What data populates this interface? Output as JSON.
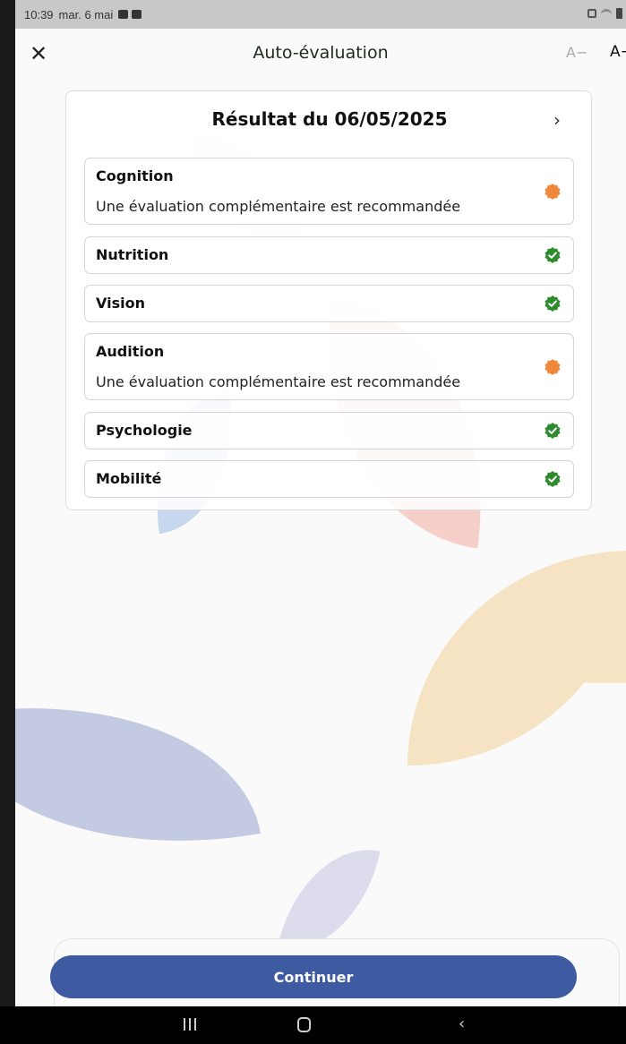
{
  "status_bar": {
    "time": "10:39",
    "date": "mar. 6 mai"
  },
  "header": {
    "close_glyph": "✕",
    "title": "Auto-évaluation",
    "font_decrease": "A−",
    "font_increase": "A+"
  },
  "card": {
    "title": "Résultat du 06/05/2025",
    "next_glyph": "›",
    "rows": [
      {
        "label": "Cognition",
        "sub": "Une évaluation complémentaire est recommandée",
        "status": "warning"
      },
      {
        "label": "Nutrition",
        "status": "ok"
      },
      {
        "label": "Vision",
        "status": "ok"
      },
      {
        "label": "Audition",
        "sub": "Une évaluation complémentaire est recommandée",
        "status": "warning"
      },
      {
        "label": "Psychologie",
        "status": "ok"
      },
      {
        "label": "Mobilité",
        "status": "ok"
      }
    ]
  },
  "colors": {
    "ok": "#2e8b2e",
    "warning": "#f0873a",
    "primary_button": "#3e5ba2"
  },
  "continue_button": {
    "label": "Continuer"
  },
  "icons": {
    "ok": "check-badge-icon",
    "warning": "orange-badge-icon",
    "close": "close-icon",
    "next": "chevron-right-icon"
  }
}
